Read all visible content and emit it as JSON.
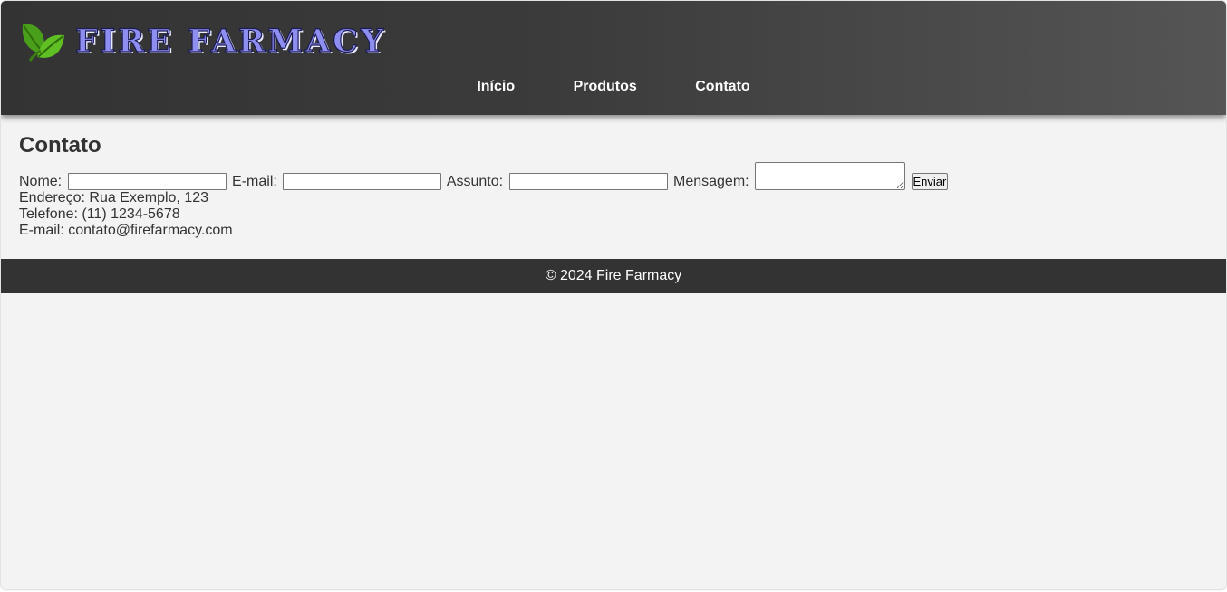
{
  "header": {
    "logo_text": "FIRE FARMACY",
    "logo_icon": "leaf-icon",
    "nav": [
      "Início",
      "Produtos",
      "Contato"
    ]
  },
  "contact": {
    "title": "Contato",
    "form": {
      "name_label": "Nome:",
      "name_value": "",
      "email_label": "E-mail:",
      "email_value": "",
      "subject_label": "Assunto:",
      "subject_value": "",
      "message_label": "Mensagem:",
      "message_value": "",
      "submit_label": "Enviar"
    },
    "address": "Endereço: Rua Exemplo, 123",
    "phone": "Telefone: (11) 1234-5678",
    "email": "E-mail: contato@firefarmacy.com"
  },
  "footer": {
    "text": "© 2024 Fire Farmacy"
  },
  "colors": {
    "header_bg": "#333333",
    "page_bg": "#f3f3f3",
    "logo_color": "#8e8ef0",
    "leaf_green": "#4caf1e"
  }
}
